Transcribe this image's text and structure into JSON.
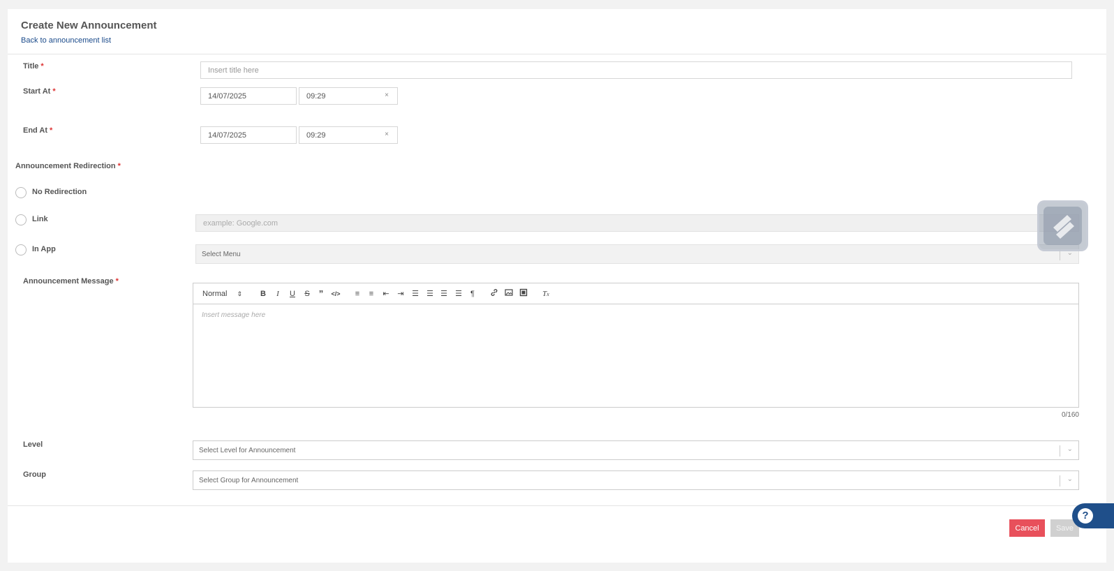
{
  "header": {
    "title": "Create New Announcement",
    "back_link": "Back to announcement list"
  },
  "form": {
    "title": {
      "label": "Title",
      "required": "*",
      "placeholder": "Insert title here"
    },
    "start_at": {
      "label": "Start At",
      "required": "*",
      "date": "14/07/2025",
      "time": "09:29",
      "clear": "×"
    },
    "end_at": {
      "label": "End At",
      "required": "*",
      "date": "14/07/2025",
      "time": "09:29",
      "clear": "×"
    },
    "redirection": {
      "label": "Announcement Redirection",
      "required": "*",
      "options": [
        {
          "label": "No Redirection"
        },
        {
          "label": "Link",
          "placeholder": "example: Google.com"
        },
        {
          "label": "In App",
          "select_placeholder": "Select Menu"
        }
      ]
    },
    "message": {
      "label": "Announcement Message",
      "required": "*",
      "toolbar_format": "Normal",
      "placeholder": "Insert message here",
      "counter": "0/160"
    },
    "level": {
      "label": "Level",
      "placeholder": "Select Level for Announcement"
    },
    "group": {
      "label": "Group",
      "placeholder": "Select Group for Announcement"
    }
  },
  "footer": {
    "cancel": "Cancel",
    "save": "Save"
  },
  "help": {
    "label": "?"
  },
  "colors": {
    "accent": "#1a4a8a",
    "danger": "#e8505b",
    "disabled": "#d0d0d0",
    "required": "#dd3333"
  }
}
